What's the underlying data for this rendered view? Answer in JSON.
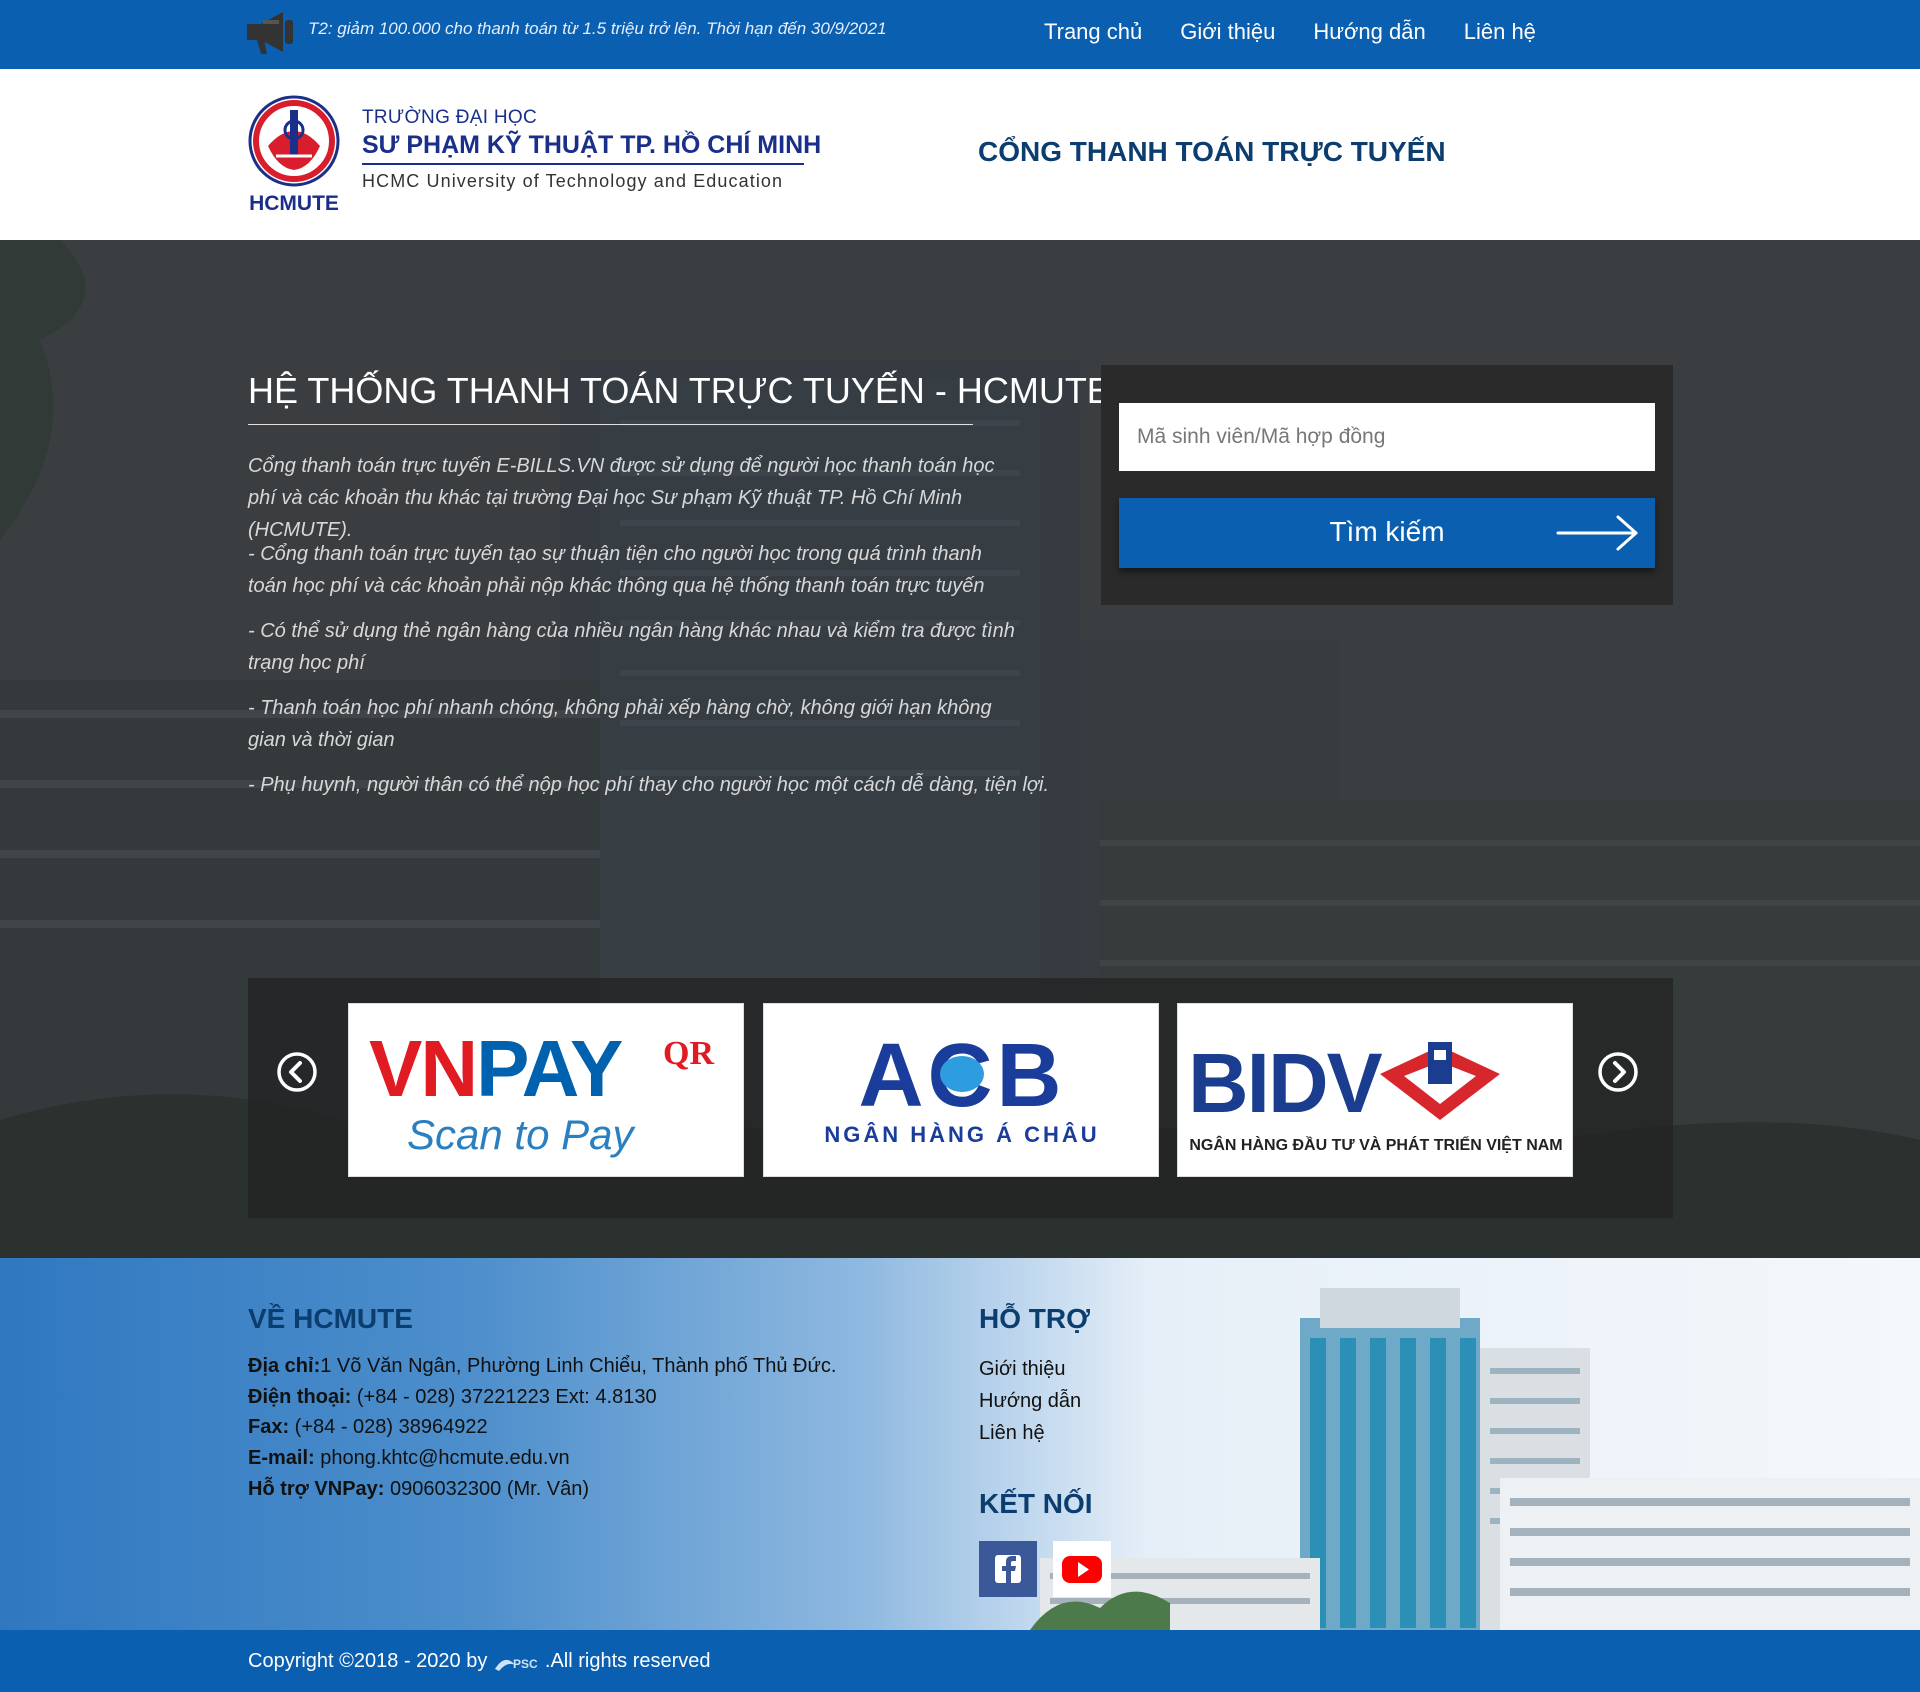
{
  "topbar": {
    "promo": "T2: giảm 100.000 cho thanh toán từ 1.5 triệu trở lên. Thời hạn đến 30/9/2021",
    "nav": [
      "Trang chủ",
      "Giới thiệu",
      "Hướng dẫn",
      "Liên hệ"
    ],
    "icon": "megaphone-icon"
  },
  "header": {
    "logo": {
      "line1": "TRƯỜNG ĐẠI HỌC",
      "line2": "SƯ PHẠM KỸ THUẬT TP. HỒ CHÍ MINH",
      "line3": "HCMC University of Technology and Education",
      "emblem_text": "HCMUTE"
    },
    "portal_title": "CỔNG THANH TOÁN TRỰC TUYẾN"
  },
  "hero": {
    "title": "HỆ THỐNG THANH TOÁN TRỰC TUYẾN - HCMUTE",
    "intro": "Cổng thanh toán trực tuyến E-BILLS.VN được sử dụng để người học thanh toán học phí và các khoản thu khác tại trường Đại học Sư phạm Kỹ thuật TP. Hồ Chí Minh (HCMUTE).",
    "bullets": [
      "- Cổng thanh toán trực tuyến tạo sự thuận tiện cho người học trong quá trình thanh toán học phí và các khoản phải nộp khác thông qua hệ thống thanh toán trực tuyến",
      "- Có thể sử dụng thẻ ngân hàng của nhiều ngân hàng khác nhau và kiểm tra được tình trạng học phí",
      "- Thanh toán học phí nhanh chóng, không phải xếp hàng chờ, không giới hạn không gian và thời gian",
      "- Phụ huynh, người thân có thể nộp học phí thay cho người học một cách dễ dàng, tiện lợi."
    ]
  },
  "search": {
    "placeholder": "Mã sinh viên/Mã hợp đồng",
    "value": "",
    "button_label": "Tìm kiếm"
  },
  "banks": [
    {
      "name": "VNPAY",
      "superscript": "QR",
      "tagline": "Scan to Pay"
    },
    {
      "name": "ACB",
      "tagline": "NGÂN HÀNG Á CHÂU"
    },
    {
      "name": "BIDV",
      "tagline": "NGÂN HÀNG ĐẦU TƯ VÀ PHÁT TRIỂN VIỆT NAM"
    }
  ],
  "footer": {
    "about_heading": "VỀ HCMUTE",
    "address_label": "Địa chỉ:",
    "address": "1 Võ Văn Ngân, Phường Linh Chiểu, Thành phố Thủ Đức.",
    "phone_label": "Điện thoại:",
    "phone": " (+84 - 028) 37221223 Ext: 4.8130",
    "fax_label": "Fax:",
    "fax": " (+84 - 028) 38964922",
    "email_label": "E-mail:",
    "email": " phong.khtc@hcmute.edu.vn",
    "vnpay_label": "Hỗ trợ VNPay:",
    "vnpay": " 0906032300 (Mr. Vân)",
    "support_heading": "HỖ TRỢ",
    "support_links": [
      "Giới thiệu",
      "Hướng dẫn",
      "Liên hệ"
    ],
    "connect_heading": "KẾT NỐI",
    "social": [
      "facebook-icon",
      "youtube-icon"
    ],
    "colors": {
      "facebook": "#3b5998",
      "youtube": "#ff0000"
    }
  },
  "bottombar": {
    "copyright_prefix": "Copyright ©2018 - 2020 by ",
    "psc": "PSC",
    "copyright_suffix": ".All rights reserved"
  },
  "colors": {
    "primary": "#0a5fb0",
    "heading": "#0b3d6e",
    "logo_blue": "#1a2f8a",
    "logo_red": "#d81e2c"
  }
}
